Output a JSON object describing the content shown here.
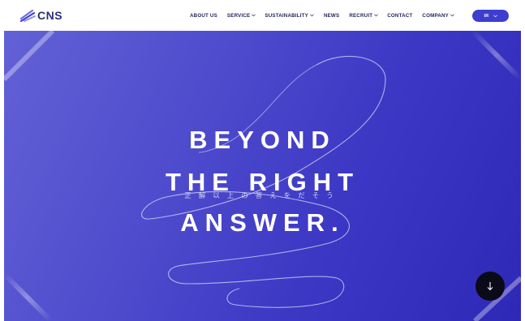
{
  "header": {
    "logo_text": "CNS",
    "nav": [
      {
        "label": "ABOUT US",
        "dropdown": false
      },
      {
        "label": "SERVICE",
        "dropdown": true
      },
      {
        "label": "SUSTAINABILITY",
        "dropdown": true
      },
      {
        "label": "NEWS",
        "dropdown": false
      },
      {
        "label": "RECRUIT",
        "dropdown": true
      },
      {
        "label": "CONTACT",
        "dropdown": false
      },
      {
        "label": "COMPANY",
        "dropdown": true
      }
    ],
    "lang_button": {
      "label": "IR",
      "dropdown": true
    }
  },
  "hero": {
    "lines": [
      "BEYOND",
      "THE RIGHT",
      "ANSWER."
    ],
    "subtitle": "正解以上の答えをだそう"
  },
  "scroll_button": {
    "icon": "arrow-down-icon"
  },
  "colors": {
    "brand_navy": "#1e2257",
    "accent_blue": "#3d3ed0",
    "hero_gradient_start": "#6361d6",
    "hero_gradient_end": "#2e28b6",
    "scroll_button_bg": "#0a0a18"
  }
}
